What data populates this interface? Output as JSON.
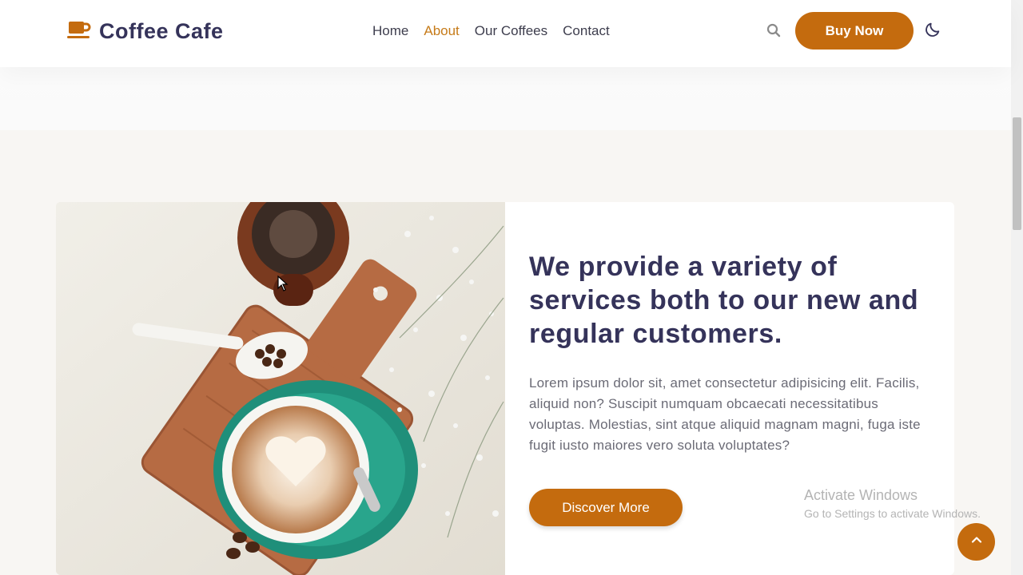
{
  "header": {
    "brand": "Coffee Cafe",
    "nav": [
      {
        "label": "Home",
        "active": false
      },
      {
        "label": "About",
        "active": true
      },
      {
        "label": "Our Coffees",
        "active": false
      },
      {
        "label": "Contact",
        "active": false
      }
    ],
    "buy_label": "Buy Now",
    "icons": {
      "logo": "coffee-cup-icon",
      "search": "search-icon",
      "theme": "moon-icon"
    }
  },
  "about": {
    "headline": "We provide a variety of services both to our new and regular customers.",
    "paragraph": "Lorem ipsum dolor sit, amet consectetur adipisicing elit. Facilis, aliquid non? Suscipit numquam obcaecati necessitatibus voluptas. Molestias, sint atque aliquid magnam magni, fuga iste fugit iusto maiores vero soluta voluptates?",
    "cta_label": "Discover More",
    "image": "coffee-latte-photo"
  },
  "watermark": {
    "title": "Activate Windows",
    "subtitle": "Go to Settings to activate Windows."
  },
  "colors": {
    "accent": "#c46b0e",
    "heading": "#35335a",
    "text": "#6b6b76",
    "background": "#f8f6f3"
  }
}
